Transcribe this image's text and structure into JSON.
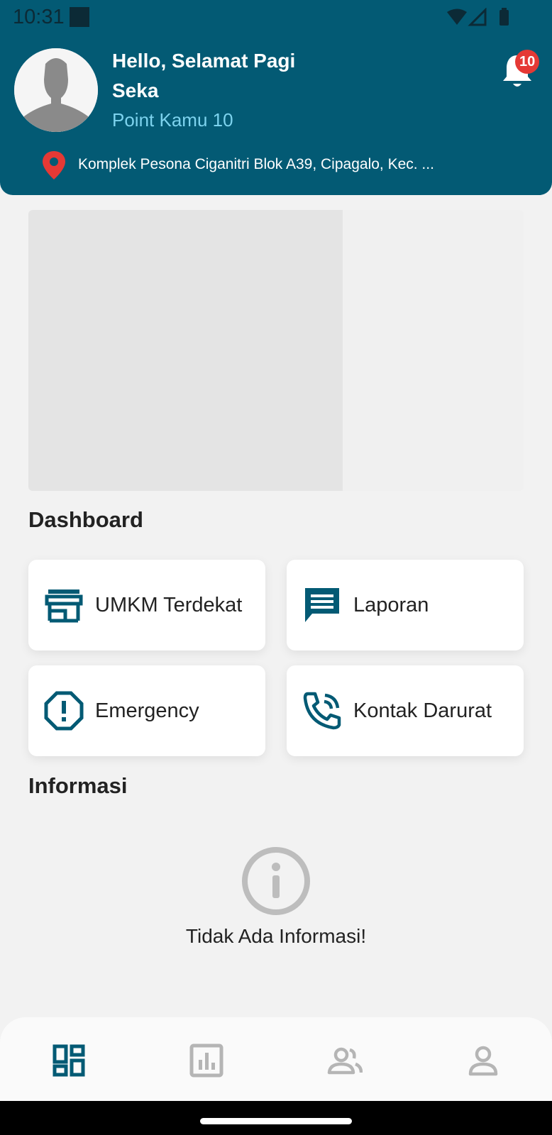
{
  "status_bar": {
    "time": "10:31"
  },
  "header": {
    "greeting": "Hello, Selamat Pagi",
    "user_name": "Seka",
    "points": "Point Kamu 10",
    "notification_count": "10",
    "address": "Komplek Pesona Ciganitri Blok A39, Cipagalo, Kec. ..."
  },
  "dashboard": {
    "title": "Dashboard",
    "cards": [
      {
        "label": "UMKM Terdekat",
        "icon": "store-icon"
      },
      {
        "label": "Laporan",
        "icon": "message-icon"
      },
      {
        "label": "Emergency",
        "icon": "alert-octagon-icon"
      },
      {
        "label": "Kontak Darurat",
        "icon": "phone-call-icon"
      }
    ]
  },
  "informasi": {
    "title": "Informasi",
    "empty_message": "Tidak Ada Informasi!"
  },
  "bottom_nav": {
    "items": [
      {
        "icon": "dashboard-icon",
        "active": true
      },
      {
        "icon": "chart-icon",
        "active": false
      },
      {
        "icon": "users-icon",
        "active": false
      },
      {
        "icon": "user-icon",
        "active": false
      }
    ]
  },
  "colors": {
    "primary": "#035a74",
    "accent_text": "#7dd3ee",
    "badge": "#e53935",
    "icon_inactive": "#b5b5b5"
  }
}
